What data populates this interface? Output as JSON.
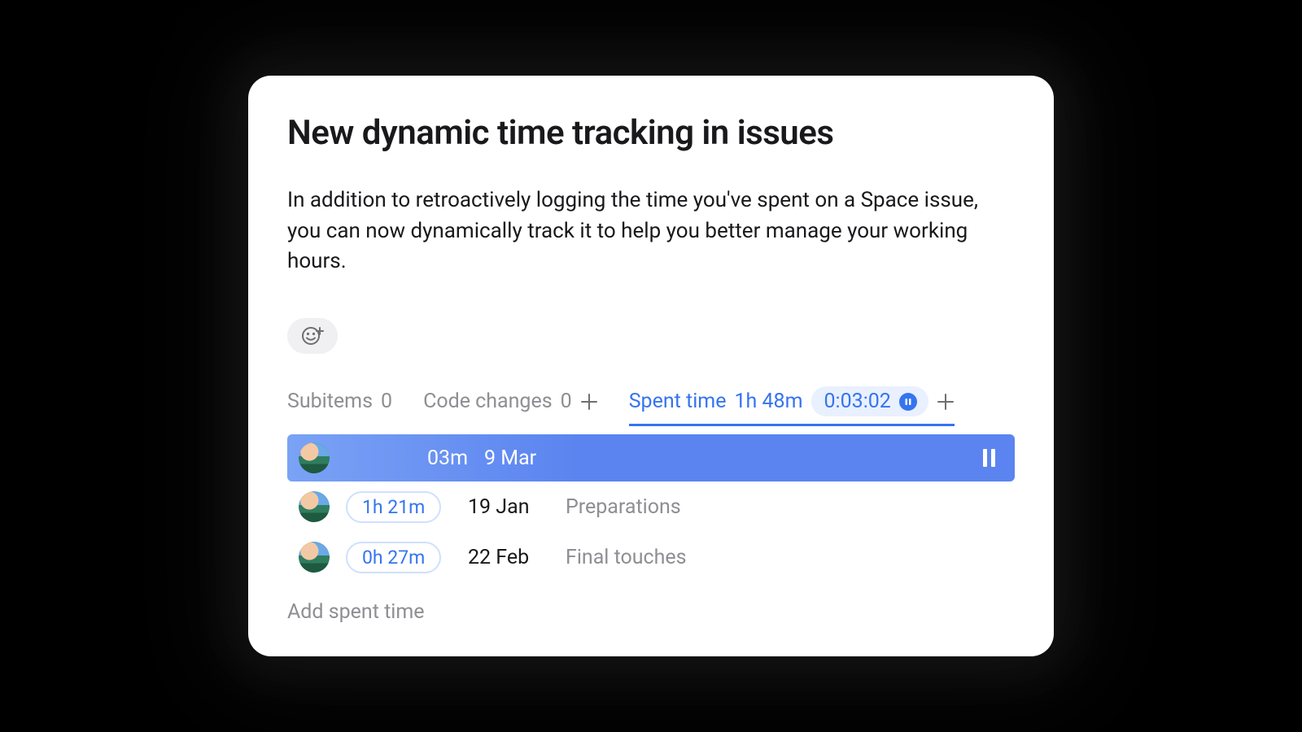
{
  "title": "New dynamic time tracking in issues",
  "description": "In addition to retroactively logging the time you've spent on a Space issue, you can now dynamically track it to help you better manage your working hours.",
  "tabs": {
    "subitems": {
      "label": "Subitems",
      "count": "0"
    },
    "code_changes": {
      "label": "Code changes",
      "count": "0"
    },
    "spent_time": {
      "label": "Spent time",
      "total": "1h 48m",
      "timer": "0:03:02"
    }
  },
  "entries": {
    "running": {
      "duration": "03m",
      "date": "9 Mar"
    },
    "list": [
      {
        "duration": "1h 21m",
        "date": "19 Jan",
        "note": "Preparations"
      },
      {
        "duration": "0h 27m",
        "date": "22 Feb",
        "note": "Final touches"
      }
    ]
  },
  "add_spent_time": "Add spent time",
  "colors": {
    "accent": "#3574f0"
  }
}
